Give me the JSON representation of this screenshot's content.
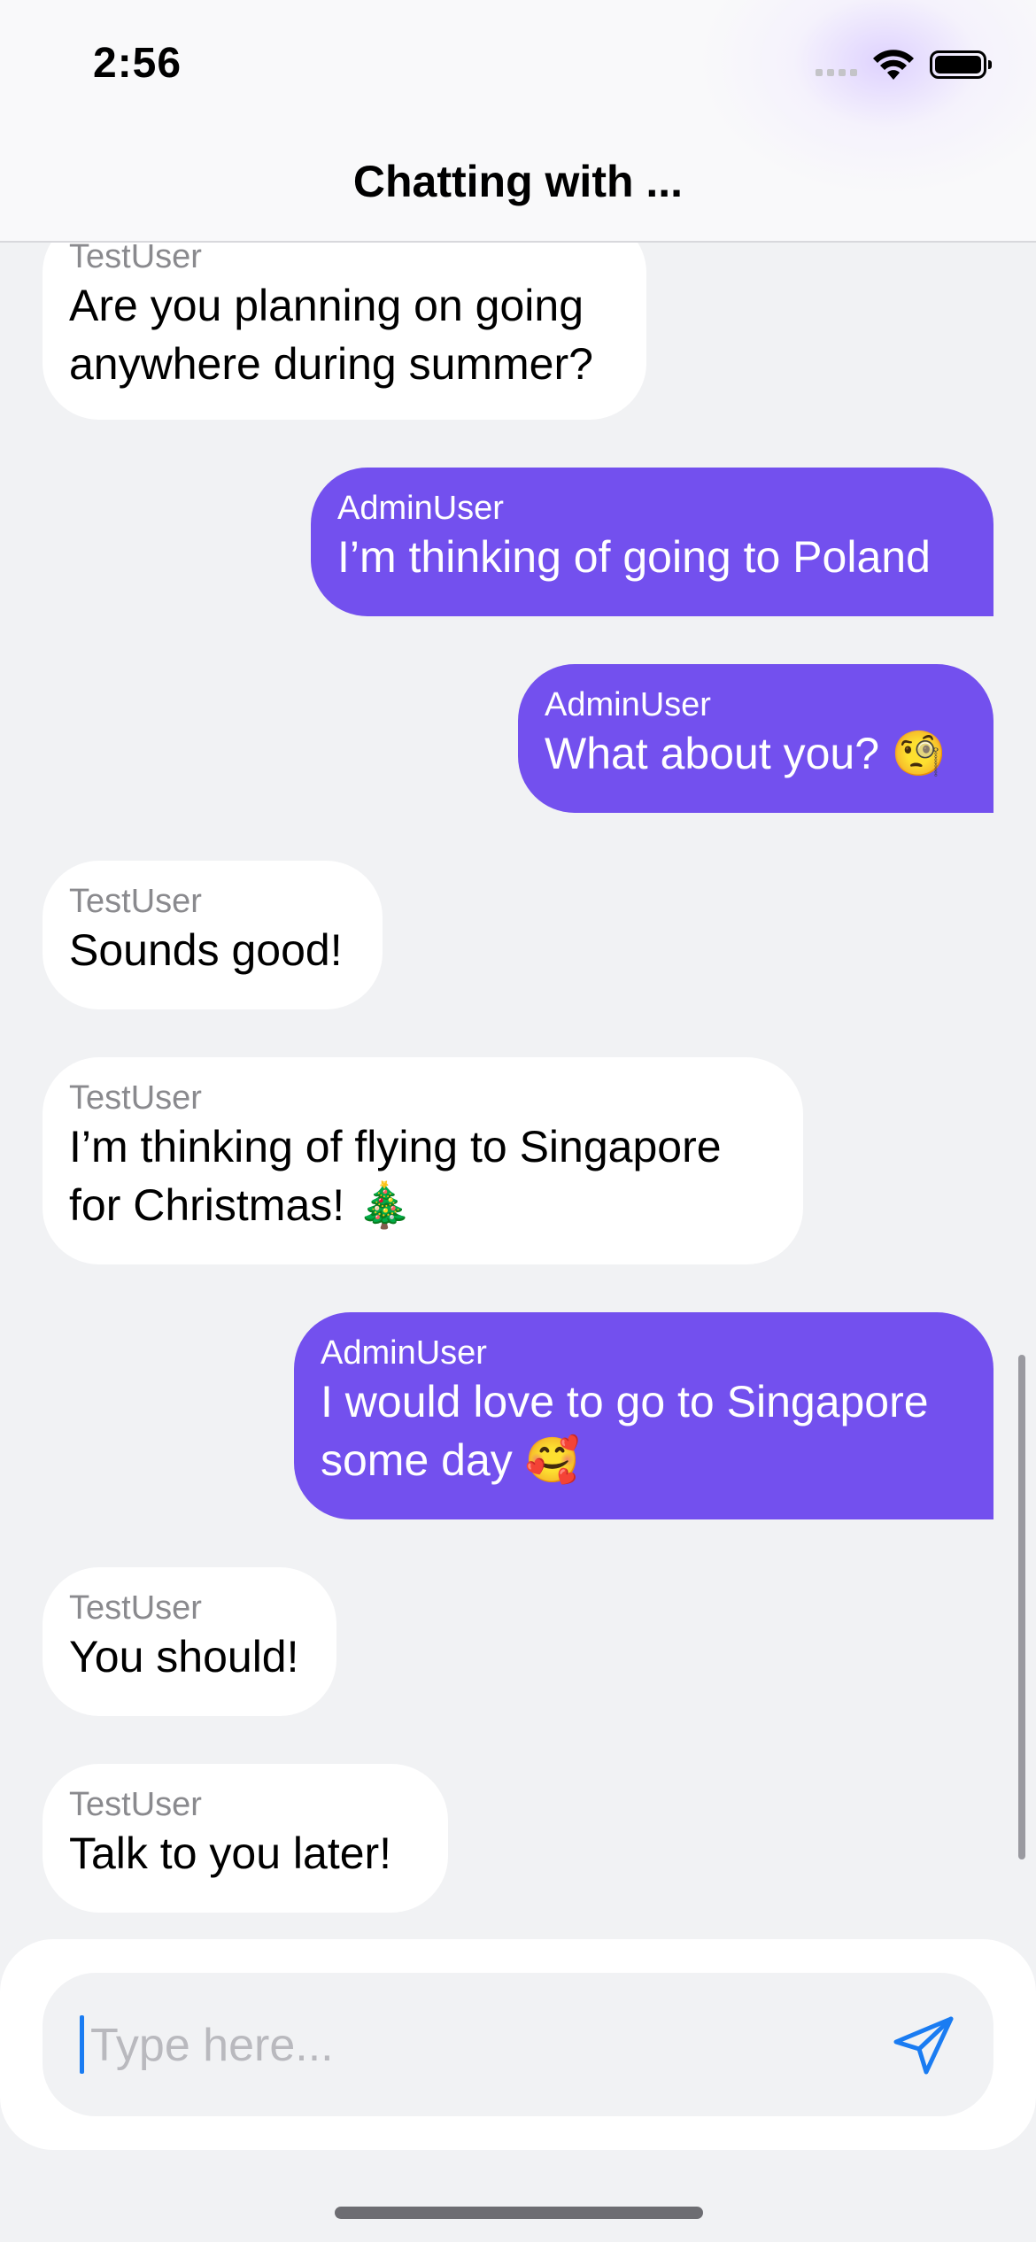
{
  "status_bar": {
    "time": "2:56"
  },
  "header": {
    "title": "Chatting with ..."
  },
  "messages": [
    {
      "sender": "TestUser",
      "line1": "Are you planning on going",
      "line2": "anywhere during summer?",
      "direction": "incoming"
    },
    {
      "sender": "AdminUser",
      "line1": "I’m thinking of going to Poland",
      "direction": "outgoing"
    },
    {
      "sender": "AdminUser",
      "line1": "What about you? 🧐",
      "direction": "outgoing"
    },
    {
      "sender": "TestUser",
      "line1": "Sounds good!",
      "direction": "incoming"
    },
    {
      "sender": "TestUser",
      "line1": "I’m thinking of flying to Singapore",
      "line2": "for Christmas! 🎄",
      "direction": "incoming"
    },
    {
      "sender": "AdminUser",
      "line1": "I would love to go to Singapore",
      "line2": "some day 🥰",
      "direction": "outgoing"
    },
    {
      "sender": "TestUser",
      "line1": "You should!",
      "direction": "incoming"
    },
    {
      "sender": "TestUser",
      "line1": "Talk to you later!",
      "direction": "incoming"
    }
  ],
  "composer": {
    "placeholder": "Type here...",
    "value": "",
    "send_icon": "send-icon"
  },
  "colors": {
    "outgoing_bubble": "#7350ee",
    "incoming_bubble": "#ffffff",
    "background": "#f1f2f4",
    "accent": "#1a7cf2"
  }
}
